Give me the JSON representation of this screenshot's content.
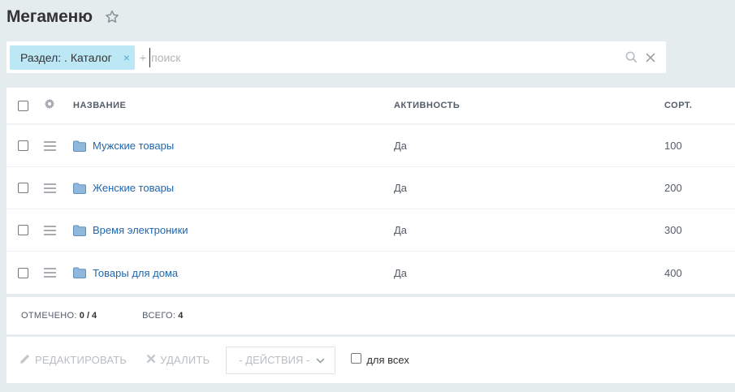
{
  "page": {
    "title": "Мегаменю"
  },
  "filter": {
    "chip_label": "Раздел: . Каталог",
    "add_label": "+",
    "search_placeholder": "поиск",
    "search_value": ""
  },
  "grid": {
    "columns": {
      "name": "НАЗВАНИЕ",
      "active": "АКТИВНОСТЬ",
      "sort": "СОРТ."
    },
    "rows": [
      {
        "name": "Мужские товары",
        "active": "Да",
        "sort": "100"
      },
      {
        "name": "Женские товары",
        "active": "Да",
        "sort": "200"
      },
      {
        "name": "Время электроники",
        "active": "Да",
        "sort": "300"
      },
      {
        "name": "Товары для дома",
        "active": "Да",
        "sort": "400"
      }
    ]
  },
  "footer": {
    "selected_label": "ОТМЕЧЕНО:",
    "selected_value": "0 / 4",
    "total_label": "ВСЕГО:",
    "total_value": "4"
  },
  "actions": {
    "edit_label": "РЕДАКТИРОВАТЬ",
    "delete_label": "УДАЛИТЬ",
    "select_label": "- ДЕЙСТВИЯ -",
    "for_all_label": "для всех"
  },
  "colors": {
    "background": "#e5ecee",
    "chip": "#bce8f6",
    "link": "#2067b0",
    "folder": "#8fb8dc"
  },
  "icons": [
    "star-icon",
    "search-icon",
    "close-icon",
    "gear-icon",
    "drag-handle-icon",
    "folder-icon",
    "pencil-icon",
    "delete-x-icon",
    "chevron-down-icon"
  ]
}
